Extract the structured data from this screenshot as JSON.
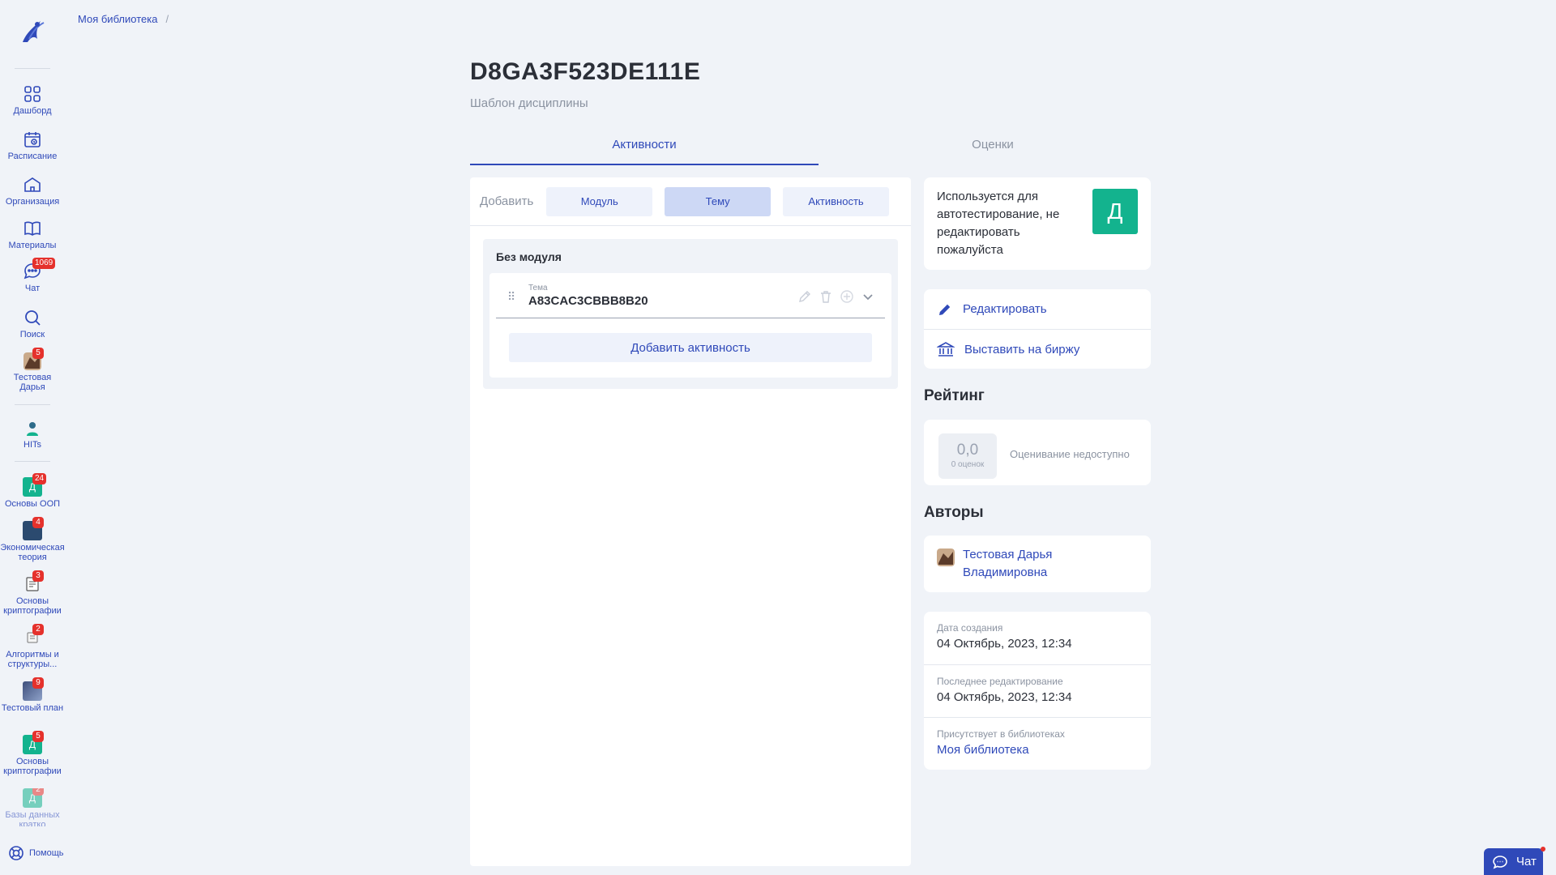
{
  "sidebar": {
    "items": [
      {
        "label": "Дашборд",
        "icon": "dashboard-icon"
      },
      {
        "label": "Расписание",
        "icon": "calendar-icon"
      },
      {
        "label": "Организация",
        "icon": "building-icon"
      },
      {
        "label": "Материалы",
        "icon": "book-icon"
      },
      {
        "label": "Чат",
        "icon": "chat-icon",
        "badge": "1069"
      },
      {
        "label": "Поиск",
        "icon": "search-icon"
      },
      {
        "label": "Тестовая Дарья",
        "icon": "user-avatar",
        "badge": "5"
      }
    ],
    "hits": {
      "label": "HITs",
      "icon": "hits-icon"
    },
    "courses": [
      {
        "label": "Основы ООП",
        "tile": "Д",
        "tile_color": "#13b38e",
        "badge": "24"
      },
      {
        "label": "Экономическая теория",
        "tile": "",
        "tile_color": "#2b4a6f",
        "badge": "4"
      },
      {
        "label": "Основы криптографии",
        "tile": "",
        "tile_color": "#e8e8e8",
        "badge": "3"
      },
      {
        "label": "Алгоритмы и структуры...",
        "tile": "",
        "tile_color": "#e8e8e8",
        "badge": "2"
      },
      {
        "label": "Тестовый план",
        "tile": "",
        "tile_color": "#5b6b8c",
        "badge": "9"
      },
      {
        "label": "Основы криптографии",
        "tile": "Д",
        "tile_color": "#13b38e",
        "badge": "5"
      },
      {
        "label": "Базы данных кратко",
        "tile": "Д",
        "tile_color": "#13b38e",
        "badge": "2"
      }
    ],
    "help_label": "Помощь"
  },
  "breadcrumb": {
    "items": [
      "Моя библиотека"
    ],
    "separator": "/"
  },
  "page": {
    "title": "D8GA3F523DE111E",
    "subtitle": "Шаблон дисциплины"
  },
  "tabs": [
    {
      "label": "Активности",
      "active": true
    },
    {
      "label": "Оценки",
      "active": false
    }
  ],
  "add_bar": {
    "label": "Добавить",
    "buttons": [
      {
        "label": "Модуль",
        "selected": false
      },
      {
        "label": "Тему",
        "selected": true
      },
      {
        "label": "Активность",
        "selected": false
      }
    ]
  },
  "module": {
    "title": "Без модуля",
    "topic": {
      "kicker": "Тема",
      "name": "A83CAC3CBBB8B20"
    },
    "add_activity_label": "Добавить активность"
  },
  "notice": {
    "text": "Используется для автотестирование, не редактировать пожалуйста",
    "avatar_letter": "Д",
    "avatar_color": "#13b38e"
  },
  "actions": [
    {
      "label": "Редактировать",
      "icon": "pencil-icon"
    },
    {
      "label": "Выставить на биржу",
      "icon": "bank-icon"
    }
  ],
  "rating": {
    "heading": "Рейтинг",
    "value": "0,0",
    "count": "0 оценок",
    "note": "Оценивание недоступно"
  },
  "authors": {
    "heading": "Авторы",
    "items": [
      {
        "name": "Тестовая Дарья Владимировна"
      }
    ]
  },
  "info": [
    {
      "key": "Дата создания",
      "value": "04 Октябрь, 2023, 12:34",
      "link": false
    },
    {
      "key": "Последнее редактирование",
      "value": "04 Октябрь, 2023, 12:34",
      "link": false
    },
    {
      "key": "Присутствует в библиотеках",
      "value": "Моя библиотека",
      "link": true
    }
  ],
  "chat_widget": {
    "label": "Чат"
  },
  "colors": {
    "accent": "#2f49b9",
    "badge": "#e5312c",
    "brand_green": "#13b38e",
    "background": "#f0f3f8"
  }
}
